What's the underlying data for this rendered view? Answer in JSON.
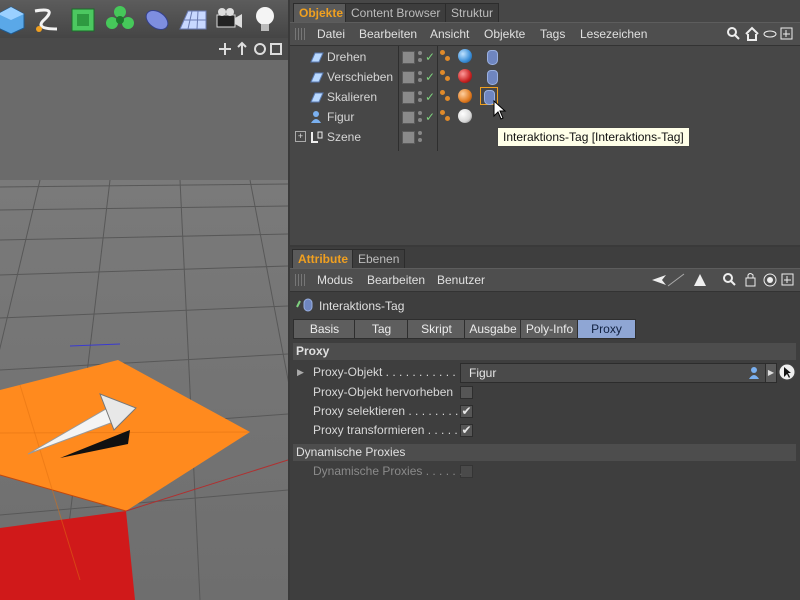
{
  "object_manager": {
    "tabs": [
      "Objekte",
      "Content Browser",
      "Struktur"
    ],
    "menu": [
      "Datei",
      "Bearbeiten",
      "Ansicht",
      "Objekte",
      "Tags",
      "Lesezeichen"
    ],
    "objects": [
      {
        "name": "Drehen",
        "ball_color": "#3a8ed8"
      },
      {
        "name": "Verschieben",
        "ball_color": "#c82222"
      },
      {
        "name": "Skalieren",
        "ball_color": "#e07a20"
      },
      {
        "name": "Figur",
        "ball_color": "#d8d8d8"
      },
      {
        "name": "Szene"
      }
    ]
  },
  "tooltip": "Interaktions-Tag [Interaktions-Tag]",
  "attribute_manager": {
    "tabs": [
      "Attribute",
      "Ebenen"
    ],
    "menu": [
      "Modus",
      "Bearbeiten",
      "Benutzer"
    ],
    "tag_title": "Interaktions-Tag",
    "subtabs": [
      "Basis",
      "Tag",
      "Skript",
      "Ausgabe",
      "Poly-Info",
      "Proxy"
    ],
    "active_subtab": "Proxy",
    "sections": {
      "proxy": {
        "title": "Proxy",
        "proxy_object_label": "Proxy-Objekt . . . . . . . . . . . .",
        "proxy_object_value": "Figur",
        "highlight_label": "Proxy-Objekt hervorheben",
        "highlight_checked": false,
        "select_label": "Proxy selektieren . . . . . . . . .",
        "select_checked": true,
        "transform_label": "Proxy transformieren . . . . .",
        "transform_checked": true
      },
      "dynamic": {
        "title": "Dynamische Proxies",
        "label": "Dynamische Proxies . . . . . .",
        "checked": false
      }
    }
  },
  "colors": {
    "accent_tab": "#f0a020",
    "active_subtab": "#8fa6d4",
    "plane_orange": "#ff8a1e",
    "plane_red": "#d0191a"
  }
}
